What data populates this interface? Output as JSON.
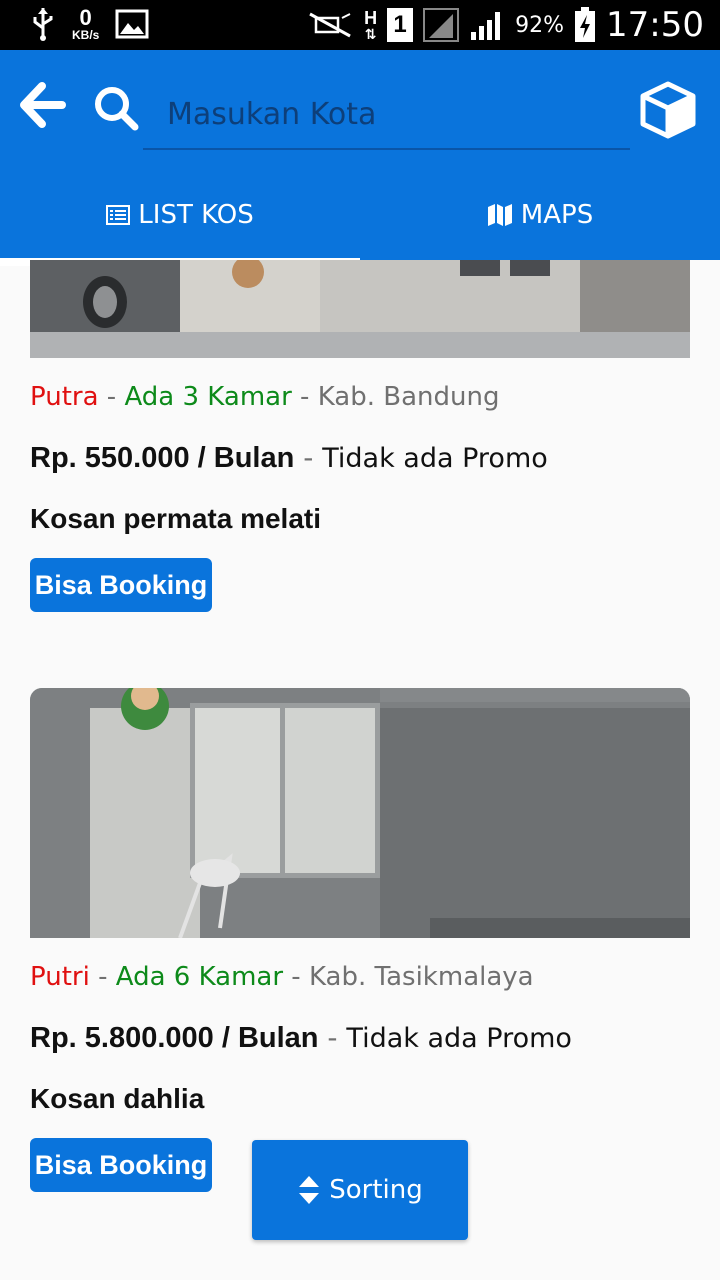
{
  "status_bar": {
    "kbs_value": "0",
    "kbs_unit": "KB/s",
    "network_type": "H",
    "sim_slot": "1",
    "battery_percent": "92%",
    "time": "17:50"
  },
  "search": {
    "placeholder": "Masukan Kota"
  },
  "tabs": [
    {
      "label": "LIST KOS",
      "icon": "list-icon",
      "active": true
    },
    {
      "label": "MAPS",
      "icon": "map-icon",
      "active": false
    }
  ],
  "listings": [
    {
      "gender": "Putra",
      "availability": "Ada 3 Kamar",
      "location": "Kab. Bandung",
      "price": "Rp. 550.000 / Bulan",
      "promo": "Tidak ada Promo",
      "name": "Kosan permata melati",
      "booking_label": "Bisa Booking"
    },
    {
      "gender": "Putri",
      "availability": "Ada 6 Kamar",
      "location": "Kab. Tasikmalaya",
      "price": "Rp. 5.800.000 / Bulan",
      "promo": "Tidak ada Promo",
      "name": "Kosan dahlia",
      "booking_label": "Bisa Booking"
    }
  ],
  "sorting_button": {
    "label": "Sorting"
  },
  "colors": {
    "primary": "#0a74dc",
    "gender": "#e01010",
    "availability": "#0d8a1a",
    "muted": "#707070"
  }
}
